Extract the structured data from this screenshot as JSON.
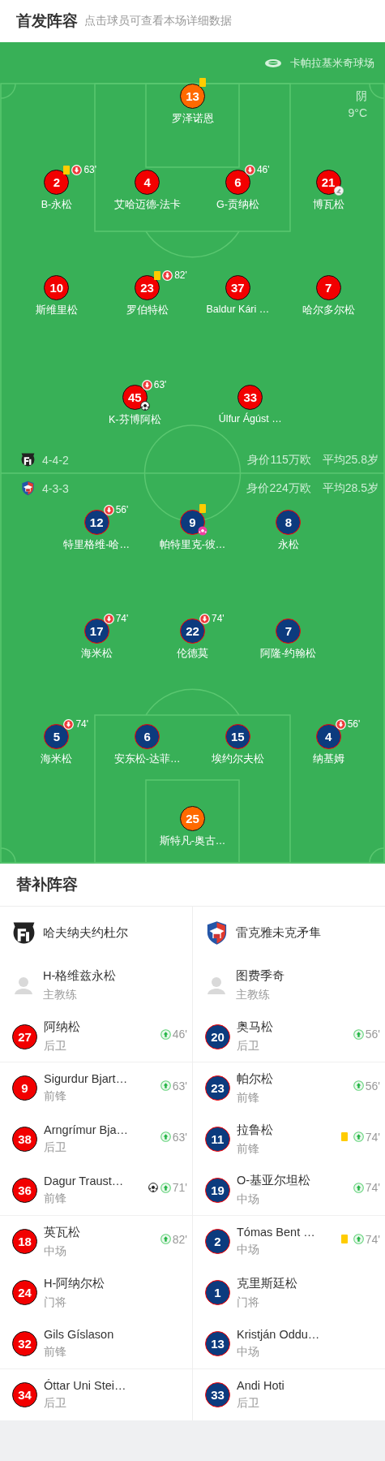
{
  "header": {
    "title": "首发阵容",
    "hint": "点击球员可查看本场详细数据"
  },
  "pitch": {
    "stadium": "卡帕拉基米奇球场",
    "weather": "阴",
    "temperature": "9°C",
    "home": {
      "kind": "home",
      "formation": "4-4-2",
      "value": "身价115万欧",
      "age": "平均25.8岁",
      "lines": [
        [
          {
            "number": "13",
            "name": "罗泽诺恩",
            "kind": "keeper",
            "yellow_card": true
          }
        ],
        [
          {
            "number": "2",
            "name": "B-永松",
            "kind": "outfield",
            "yellow_card": true,
            "sub_out": "63'"
          },
          {
            "number": "4",
            "name": "艾哈迈德-法卡",
            "kind": "outfield",
            "yellow_card": false
          },
          {
            "number": "6",
            "name": "G-贡纳松",
            "kind": "outfield",
            "yellow_card": false,
            "sub_out": "46'"
          },
          {
            "number": "21",
            "name": "博瓦松",
            "kind": "outfield",
            "yellow_card": false,
            "event": {
              "kind": "assist"
            }
          }
        ],
        [
          {
            "number": "10",
            "name": "斯维里松",
            "kind": "outfield",
            "yellow_card": false
          },
          {
            "number": "23",
            "name": "罗伯特松",
            "kind": "outfield",
            "yellow_card": true,
            "sub_out": "82'"
          },
          {
            "number": "37",
            "name": "Baldur Kári …",
            "kind": "outfield",
            "yellow_card": false
          },
          {
            "number": "7",
            "name": "哈尔多尔松",
            "kind": "outfield",
            "yellow_card": false
          }
        ],
        [
          {
            "number": "45",
            "name": "K-芬博阿松",
            "kind": "outfield",
            "yellow_card": false,
            "sub_out": "63'",
            "event": {
              "kind": "goal"
            }
          },
          {
            "number": "33",
            "name": "Úlfur Ágúst …",
            "kind": "outfield",
            "yellow_card": false
          }
        ]
      ]
    },
    "away": {
      "kind": "away",
      "formation": "4-3-3",
      "value": "身价224万欧",
      "age": "平均28.5岁",
      "lines": [
        [
          {
            "number": "12",
            "name": "特里格维-哈…",
            "kind": "outfield",
            "yellow_card": false,
            "sub_out": "56'"
          },
          {
            "number": "9",
            "name": "帕特里克-彼…",
            "kind": "outfield",
            "yellow_card": true,
            "event": {
              "kind": "own_goal"
            }
          },
          {
            "number": "8",
            "name": "永松",
            "kind": "outfield",
            "yellow_card": false
          }
        ],
        [
          {
            "number": "17",
            "name": "海米松",
            "kind": "outfield",
            "yellow_card": false,
            "sub_out": "74'"
          },
          {
            "number": "22",
            "name": "伦德莫",
            "kind": "outfield",
            "yellow_card": false,
            "sub_out": "74'"
          },
          {
            "number": "7",
            "name": "阿隆-约翰松",
            "kind": "outfield",
            "yellow_card": false
          }
        ],
        [
          {
            "number": "5",
            "name": "海米松",
            "kind": "outfield",
            "yellow_card": false,
            "sub_out": "74'"
          },
          {
            "number": "6",
            "name": "安东松-达菲…",
            "kind": "outfield",
            "yellow_card": false
          },
          {
            "number": "15",
            "name": "埃约尔夫松",
            "kind": "outfield",
            "yellow_card": false
          },
          {
            "number": "4",
            "name": "纳基姆",
            "kind": "outfield",
            "yellow_card": false,
            "sub_out": "56'"
          }
        ],
        [
          {
            "number": "25",
            "name": "斯特凡-奥古…",
            "kind": "keeper",
            "yellow_card": false
          }
        ]
      ]
    }
  },
  "subs": {
    "title": "替补阵容",
    "teams": [
      {
        "kind": "home",
        "name": "哈夫纳夫约杜尔",
        "coach": {
          "name": "H-格维兹永松",
          "role": "主教练"
        },
        "players": [
          {
            "number": "27",
            "name": "阿纳松",
            "position": "后卫",
            "goal": false,
            "yellow_card": false,
            "sub_in": "46'"
          },
          {
            "number": "9",
            "name": "Sigurdur Bjart…",
            "position": "前锋",
            "goal": false,
            "yellow_card": false,
            "sub_in": "63'"
          },
          {
            "number": "38",
            "name": "Arngrímur Bja…",
            "position": "后卫",
            "goal": false,
            "yellow_card": false,
            "sub_in": "63'"
          },
          {
            "number": "36",
            "name": "Dagur Traust…",
            "position": "前锋",
            "goal": true,
            "yellow_card": false,
            "sub_in": "71'"
          },
          {
            "number": "18",
            "name": "英瓦松",
            "position": "中场",
            "goal": false,
            "yellow_card": false,
            "sub_in": "82'"
          },
          {
            "number": "24",
            "name": "H-阿纳尔松",
            "position": "门将",
            "goal": false,
            "yellow_card": false
          },
          {
            "number": "32",
            "name": "Gils Gíslason",
            "position": "前锋",
            "goal": false,
            "yellow_card": false
          },
          {
            "number": "34",
            "name": "Óttar Uni Stei…",
            "position": "后卫",
            "goal": false,
            "yellow_card": false
          }
        ]
      },
      {
        "kind": "away",
        "name": "雷克雅未克矛隼",
        "coach": {
          "name": "图费季奇",
          "role": "主教练"
        },
        "players": [
          {
            "number": "20",
            "name": "奥马松",
            "position": "后卫",
            "goal": false,
            "yellow_card": false,
            "sub_in": "56'"
          },
          {
            "number": "23",
            "name": "帕尔松",
            "position": "前锋",
            "goal": false,
            "yellow_card": false,
            "sub_in": "56'"
          },
          {
            "number": "11",
            "name": "拉鲁松",
            "position": "前锋",
            "goal": false,
            "yellow_card": true,
            "sub_in": "74'"
          },
          {
            "number": "19",
            "name": "O-基亚尔坦松",
            "position": "中场",
            "goal": false,
            "yellow_card": false,
            "sub_in": "74'"
          },
          {
            "number": "2",
            "name": "Tómas Bent …",
            "position": "中场",
            "goal": false,
            "yellow_card": true,
            "sub_in": "74'"
          },
          {
            "number": "1",
            "name": "克里斯廷松",
            "position": "门将",
            "goal": false,
            "yellow_card": false
          },
          {
            "number": "13",
            "name": "Kristján Oddu…",
            "position": "中场",
            "goal": false,
            "yellow_card": false
          },
          {
            "number": "33",
            "name": "Andi Hoti",
            "position": "后卫",
            "goal": false,
            "yellow_card": false
          }
        ]
      }
    ]
  }
}
